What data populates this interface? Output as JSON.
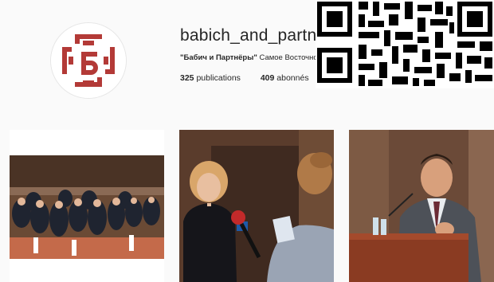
{
  "profile": {
    "username": "babich_and_partners",
    "bio_bold": "\"Бабич и Партнёры\"",
    "bio_rest": " Самое Восточное юридическое агентство",
    "publications_count": "325",
    "publications_label": "publications",
    "followers_count": "409",
    "followers_label": "abonnés"
  },
  "logo": {
    "glyph": "б",
    "color": "#b33a37"
  },
  "qr_code": {
    "description_icon": "qr-code-icon"
  },
  "posts": [
    {
      "name": "conference-audience-photo"
    },
    {
      "name": "interview-photo"
    },
    {
      "name": "speaker-at-podium-photo"
    }
  ],
  "colors": {
    "accent": "#b33a37",
    "text": "#262626",
    "background": "#fafafa"
  }
}
